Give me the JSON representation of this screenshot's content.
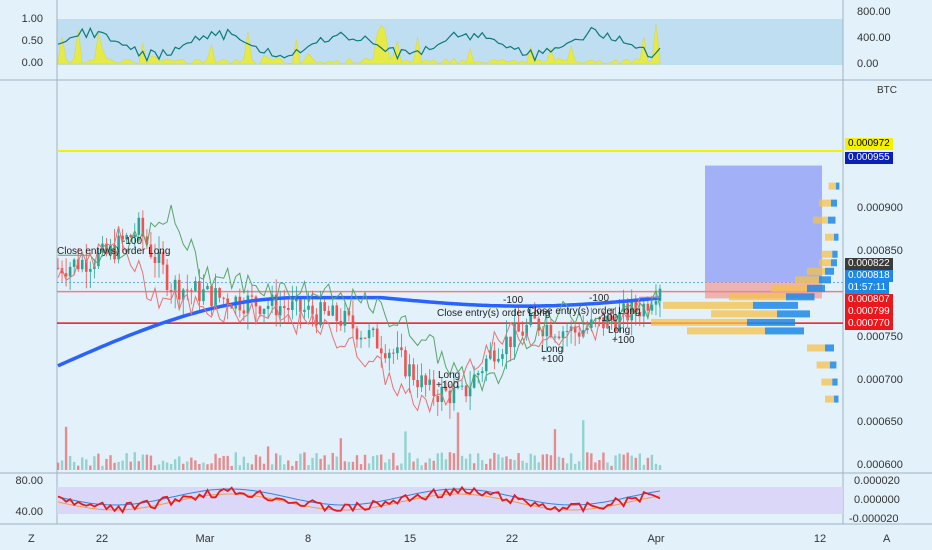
{
  "symbol_unit": "BTC",
  "top_indicator": {
    "left_ticks": [
      "1.00",
      "0.50",
      "0.00"
    ],
    "right_ticks": [
      "800.00",
      "400.00",
      "0.00"
    ]
  },
  "main_axis": {
    "ticks": [
      "0.000900",
      "0.000850",
      "0.000750",
      "0.000700",
      "0.000650",
      "0.000600"
    ]
  },
  "price_labels": [
    {
      "name": "level-yellow",
      "value": "0.000972",
      "bg": "#f5f000",
      "fg": "#000000"
    },
    {
      "name": "level-blue",
      "value": "0.000955",
      "bg": "#0a1fb8",
      "fg": "#ffffff"
    },
    {
      "name": "level-dark",
      "value": "0.000822",
      "bg": "#3b3b3b",
      "fg": "#ffffff"
    },
    {
      "name": "last-price",
      "value": "0.000818",
      "bg": "#1e88e5",
      "fg": "#ffffff"
    },
    {
      "name": "countdown",
      "value": "01:57:11",
      "bg": "#1e88e5",
      "fg": "#ffffff"
    },
    {
      "name": "level-red-1",
      "value": "0.000807",
      "bg": "#e8191c",
      "fg": "#ffffff"
    },
    {
      "name": "level-red-2",
      "value": "0.000799",
      "bg": "#e8191c",
      "fg": "#ffffff"
    },
    {
      "name": "level-red-3",
      "value": "0.000770",
      "bg": "#e8191c",
      "fg": "#ffffff"
    }
  ],
  "bottom_indicator": {
    "left_ticks": [
      "80.00",
      "40.00"
    ],
    "right_ticks": [
      "0.000020",
      "0.000000",
      "-0.000020"
    ]
  },
  "x_axis": {
    "labels": [
      "22",
      "Mar",
      "8",
      "15",
      "22",
      "Apr",
      "12"
    ]
  },
  "footer": {
    "left_letter": "Z",
    "right_letter": "A"
  },
  "annotations": [
    {
      "text": "-100",
      "kind": "plain"
    },
    {
      "text": "Close entry(s) order Long",
      "kind": "plain"
    },
    {
      "text": "Close entry(s) order Long",
      "kind": "plain"
    },
    {
      "text": "-100",
      "kind": "plain"
    },
    {
      "text": "-100",
      "kind": "plain"
    },
    {
      "text": "Close entry(s) order Long",
      "kind": "plain"
    },
    {
      "text": "-100",
      "kind": "plain"
    },
    {
      "text": "Long",
      "kind": "plain"
    },
    {
      "text": "+100",
      "kind": "plain"
    },
    {
      "text": "Long",
      "kind": "plain"
    },
    {
      "text": "+100",
      "kind": "plain"
    },
    {
      "text": "Long",
      "kind": "plain"
    },
    {
      "text": "+100",
      "kind": "plain"
    }
  ],
  "colors": {
    "background": "#e3f1fb",
    "candle_up": "#26a69a",
    "candle_down": "#ef5350",
    "ma_line": "#2962ff",
    "yellow_line": "#f5f000",
    "red_line": "#e8191c",
    "target_box": "#7f8ff5"
  }
}
